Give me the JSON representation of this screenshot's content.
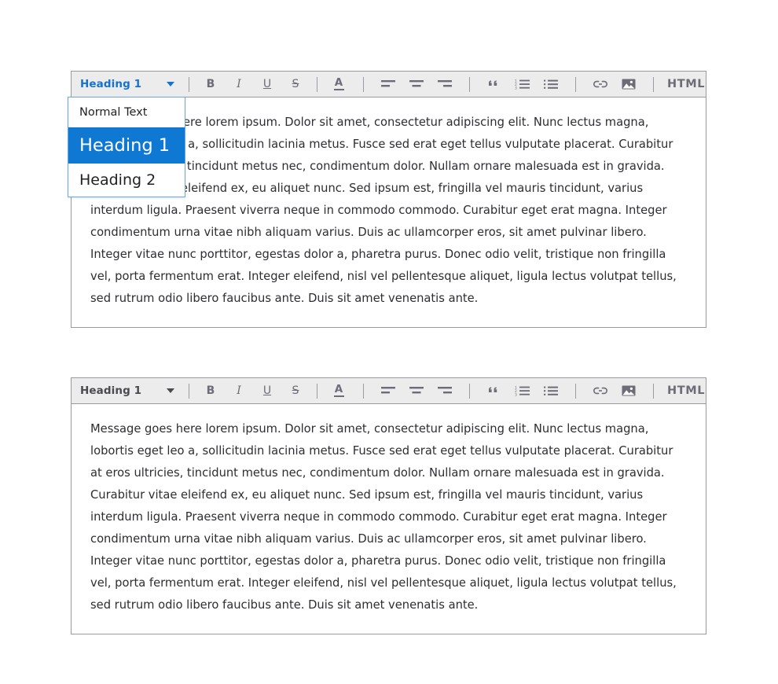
{
  "theme": {
    "accent": "#0f78d2",
    "toolbar_bg": "#ececec",
    "border": "#9a9a9e",
    "icon": "#6d6d77",
    "text": "#2d2d32",
    "dropdown_border": "#6aa9e0"
  },
  "editors": [
    {
      "id": "editor-top",
      "toolbar": {
        "style_select": {
          "value": "Heading 1",
          "state": "open",
          "caret_icon": "chevron-down-icon"
        },
        "buttons": [
          {
            "name": "bold-button",
            "label": "B",
            "icon": "bold-icon"
          },
          {
            "name": "italic-button",
            "label": "I",
            "icon": "italic-icon"
          },
          {
            "name": "underline-button",
            "label": "U",
            "icon": "underline-icon"
          },
          {
            "name": "strikethrough-button",
            "label": "S",
            "icon": "strikethrough-icon"
          },
          {
            "name": "font-color-button",
            "label": "A",
            "icon": "font-color-icon"
          },
          {
            "name": "align-left-button",
            "label": "",
            "icon": "align-left-icon"
          },
          {
            "name": "align-center-button",
            "label": "",
            "icon": "align-center-icon"
          },
          {
            "name": "align-right-button",
            "label": "",
            "icon": "align-right-icon"
          },
          {
            "name": "blockquote-button",
            "label": "",
            "icon": "quote-icon"
          },
          {
            "name": "ordered-list-button",
            "label": "",
            "icon": "ordered-list-icon"
          },
          {
            "name": "unordered-list-button",
            "label": "",
            "icon": "unordered-list-icon"
          },
          {
            "name": "insert-link-button",
            "label": "",
            "icon": "link-icon"
          },
          {
            "name": "insert-image-button",
            "label": "",
            "icon": "image-icon"
          },
          {
            "name": "html-source-button",
            "label": "HTML",
            "icon": "html-icon"
          }
        ],
        "html_label": "HTML"
      },
      "dropdown": {
        "open": true,
        "options": [
          {
            "label": "Normal Text",
            "selected": false,
            "size": "normal"
          },
          {
            "label": "Heading 1",
            "selected": true,
            "size": "h1"
          },
          {
            "label": "Heading 2",
            "selected": false,
            "size": "h2"
          }
        ]
      },
      "content": "Message goes here lorem ipsum. Dolor sit amet, consectetur adipiscing elit. Nunc lectus magna, lobortis eget leo a, sollicitudin lacinia metus. Fusce sed erat eget tellus vulputate placerat. Curabitur at eros ultricies, tincidunt metus nec, condimentum dolor. Nullam ornare malesuada est in gravida. Curabitur vitae eleifend ex, eu aliquet nunc. Sed ipsum est, fringilla vel mauris tincidunt, varius interdum ligula. Praesent viverra neque in commodo commodo. Curabitur eget erat magna. Integer condimentum urna vitae nibh aliquam varius. Duis ac ullamcorper eros, sit amet pulvinar libero. Integer vitae nunc porttitor, egestas dolor a, pharetra purus. Donec odio velit, tristique non fringilla vel, porta fermentum erat. Integer eleifend, nisl vel pellentesque aliquet, ligula lectus volutpat tellus, sed rutrum odio libero faucibus ante. Duis sit amet venenatis ante."
    },
    {
      "id": "editor-bottom",
      "toolbar": {
        "style_select": {
          "value": "Heading 1",
          "state": "closed",
          "caret_icon": "chevron-down-icon"
        },
        "html_label": "HTML"
      },
      "dropdown": {
        "open": false,
        "options": []
      },
      "content": "Message goes here lorem ipsum. Dolor sit amet, consectetur adipiscing elit. Nunc lectus magna, lobortis eget leo a, sollicitudin lacinia metus. Fusce sed erat eget tellus vulputate placerat. Curabitur at eros ultricies, tincidunt metus nec, condimentum dolor. Nullam ornare malesuada est in gravida. Curabitur vitae eleifend ex, eu aliquet nunc. Sed ipsum est, fringilla vel mauris tincidunt, varius interdum ligula. Praesent viverra neque in commodo commodo. Curabitur eget erat magna. Integer condimentum urna vitae nibh aliquam varius. Duis ac ullamcorper eros, sit amet pulvinar libero. Integer vitae nunc porttitor, egestas dolor a, pharetra purus. Donec odio velit, tristique non fringilla vel, porta fermentum erat. Integer eleifend, nisl vel pellentesque aliquet, ligula lectus volutpat tellus, sed rutrum odio libero faucibus ante. Duis sit amet venenatis ante."
    }
  ]
}
